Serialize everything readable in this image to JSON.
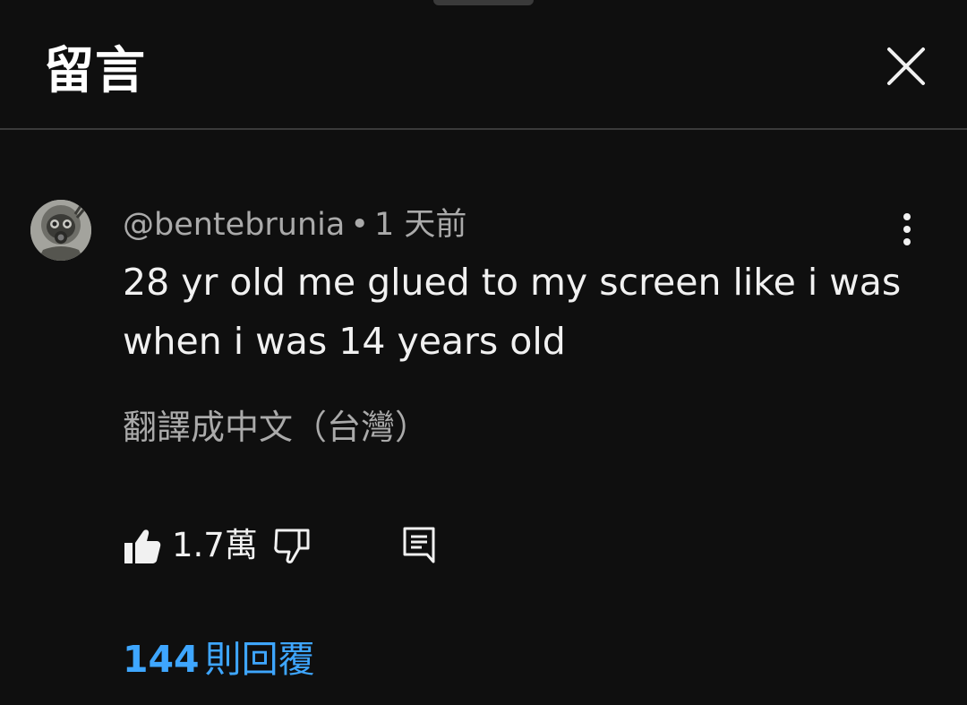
{
  "header": {
    "title": "留言",
    "close_icon": "close-icon"
  },
  "comment": {
    "handle": "@bentebrunia",
    "separator": "•",
    "time": "1 天前",
    "text": "28 yr old me glued to my screen like i was when i was 14 years old",
    "translate_label": "翻譯成中文（台灣）",
    "avatar_icon": "gas-mask-avatar",
    "more_icon": "more-vert-icon"
  },
  "actions": {
    "like_icon": "thumb-up-icon",
    "like_count": "1.7萬",
    "dislike_icon": "thumb-down-icon",
    "reply_icon": "comment-reply-icon"
  },
  "replies": {
    "count": "144",
    "label": "則回覆"
  },
  "colors": {
    "background": "#0f0f0f",
    "text_primary": "#f1f1f1",
    "text_secondary": "#aaaaaa",
    "link_blue": "#3ea6ff",
    "divider": "#3a3a3a"
  }
}
